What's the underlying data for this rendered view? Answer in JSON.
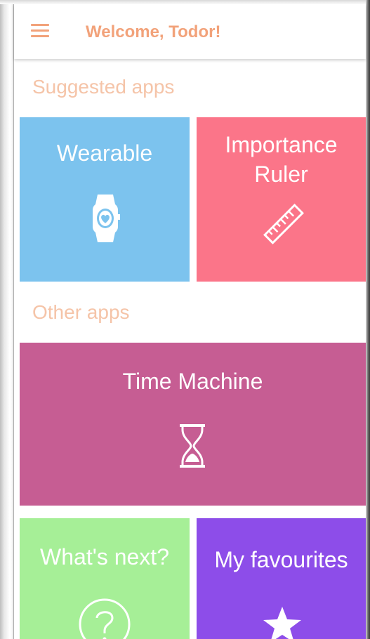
{
  "header": {
    "menu_icon": "hamburger-menu-icon",
    "title": "Welcome, Todor!",
    "accent_color": "#f2a27a"
  },
  "suggested": {
    "heading": "Suggested apps",
    "tiles": [
      {
        "label": "Wearable",
        "icon": "smartwatch-heart-icon",
        "color": "#7cc3ee"
      },
      {
        "label": "Importance\nRuler",
        "icon": "ruler-icon",
        "color": "#fb7589"
      }
    ]
  },
  "other": {
    "heading": "Other apps",
    "tiles": [
      {
        "label": "Time Machine",
        "icon": "hourglass-icon",
        "color": "#c65d93"
      },
      {
        "label": "What's next?",
        "icon": "question-circle-icon",
        "color": "#a6ef97"
      },
      {
        "label": "My favourites",
        "icon": "star-icon",
        "color": "#8d4de9"
      }
    ]
  }
}
